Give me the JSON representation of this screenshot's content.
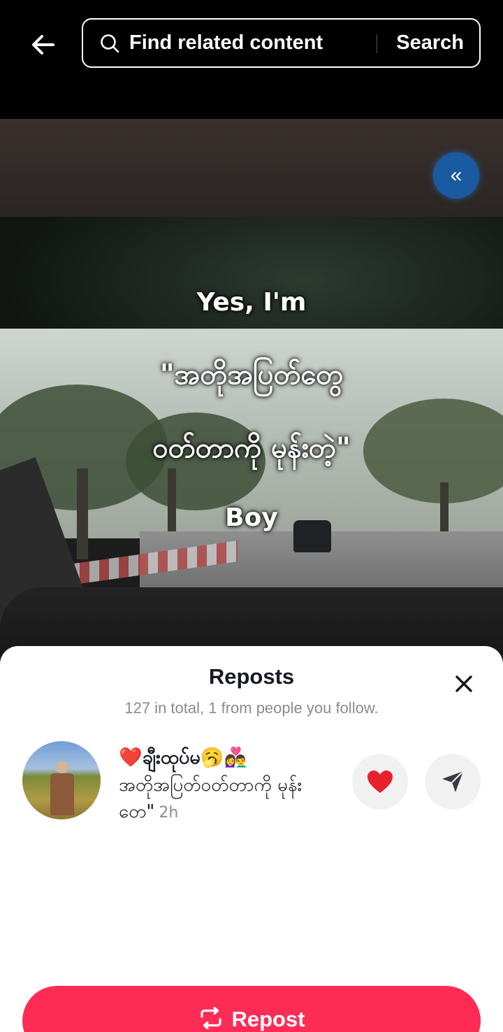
{
  "search": {
    "placeholder": "Find related content",
    "button_label": "Search"
  },
  "video": {
    "overlay_lines": [
      "Yes, I'm",
      "\"အတိုအပြတ်တွေ",
      "ဝတ်တာကို မုန်းတဲ့\"",
      "Boy"
    ],
    "expand_icon": "«"
  },
  "sheet": {
    "title": "Reposts",
    "subtitle": "127 in total, 1 from people you follow.",
    "users": [
      {
        "name": "❤️ချီးထုပ်မ🥱👩‍❤️‍👨",
        "caption": "အတိုအပြတ်ဝတ်တာကို မုန်းတေ\"",
        "time": "2h"
      }
    ],
    "repost_label": "Repost"
  },
  "colors": {
    "accent": "#fe2c55",
    "expand_button": "#1a5aa0",
    "like_heart": "#e8202e"
  },
  "icons": [
    "back-arrow-icon",
    "search-icon",
    "expand-icon",
    "close-icon",
    "heart-icon",
    "send-icon",
    "repost-icon"
  ]
}
